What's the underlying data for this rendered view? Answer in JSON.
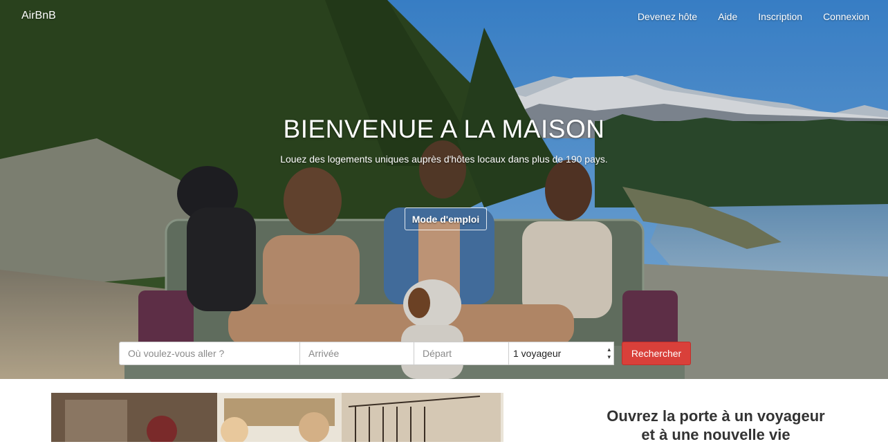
{
  "nav": {
    "brand": "AirBnB",
    "links": [
      {
        "label": "Devenez hôte"
      },
      {
        "label": "Aide"
      },
      {
        "label": "Inscription"
      },
      {
        "label": "Connexion"
      }
    ]
  },
  "hero": {
    "title": "BIENVENUE A LA MAISON",
    "subtitle": "Louez des logements uniques auprès d'hôtes locaux dans plus de 190 pays.",
    "howto_button": "Mode d'emploi"
  },
  "search": {
    "where_placeholder": "Où voulez-vous aller ?",
    "arrival_placeholder": "Arrivée",
    "departure_placeholder": "Départ",
    "guests_selected": "1 voyageur",
    "submit_label": "Rechercher"
  },
  "promo": {
    "title_line1": "Ouvrez la porte à un voyageur",
    "title_line2": "et à une nouvelle vie"
  },
  "colors": {
    "search_button": "#d9403a",
    "sky": "#5a9fdc",
    "forest": "#2f4a22",
    "lake": "#8fb8d8"
  }
}
